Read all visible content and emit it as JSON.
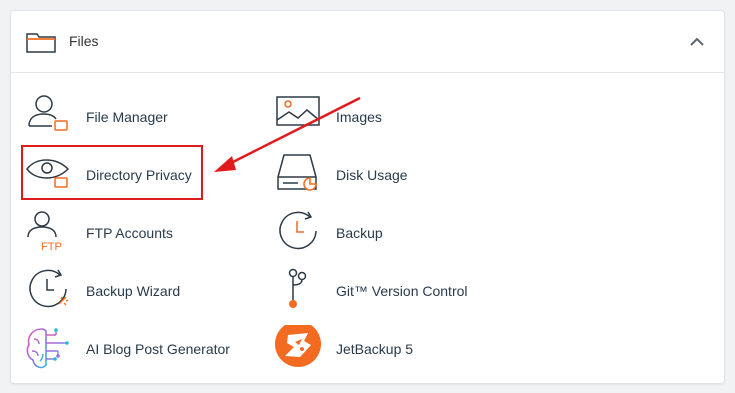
{
  "section": {
    "title": "Files",
    "collapse_icon": "chevron-up-icon",
    "header_icon": "folder-icon"
  },
  "tools": {
    "file_manager": {
      "label": "File Manager",
      "icon": "file-manager-icon"
    },
    "images": {
      "label": "Images",
      "icon": "images-icon"
    },
    "directory_privacy": {
      "label": "Directory Privacy",
      "icon": "directory-privacy-icon"
    },
    "disk_usage": {
      "label": "Disk Usage",
      "icon": "disk-usage-icon"
    },
    "ftp_accounts": {
      "label": "FTP Accounts",
      "icon": "ftp-accounts-icon",
      "icon_text": "FTP"
    },
    "backup": {
      "label": "Backup",
      "icon": "backup-icon"
    },
    "backup_wizard": {
      "label": "Backup Wizard",
      "icon": "backup-wizard-icon"
    },
    "git_version_control": {
      "label": "Git™ Version Control",
      "icon": "git-icon"
    },
    "ai_blog_post_generator": {
      "label": "AI Blog Post Generator",
      "icon": "ai-brain-icon"
    },
    "jetbackup": {
      "label": "JetBackup 5",
      "icon": "jetbackup-icon"
    }
  },
  "annotation": {
    "highlight_color": "#e01b1b",
    "highlighted_item": "Directory Privacy"
  },
  "colors": {
    "accent_orange": "#f26b21",
    "icon_dark": "#2d3a45",
    "label": "#293a4a"
  }
}
